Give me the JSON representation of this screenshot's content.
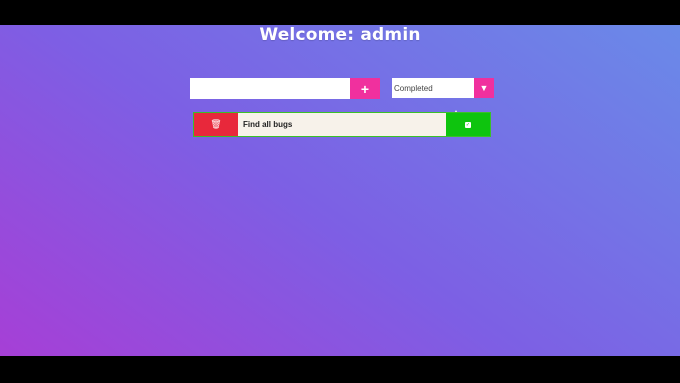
{
  "header": {
    "title": "Welcome: admin"
  },
  "form": {
    "input_value": "",
    "add_icon": "plus-icon",
    "add_label": "+",
    "filter_selected": "Completed",
    "filter_arrow": "▼"
  },
  "todos": [
    {
      "text": "Find all bugs",
      "delete_icon": "trash-icon",
      "complete_icon": "check-icon",
      "trash_glyph": "🗑",
      "check_glyph": "✓"
    }
  ],
  "colors": {
    "accent": "#f0309e",
    "delete": "#e8283b",
    "complete": "#0ec40e",
    "bg_start": "#a63fd6",
    "bg_end": "#6a8ae8"
  }
}
